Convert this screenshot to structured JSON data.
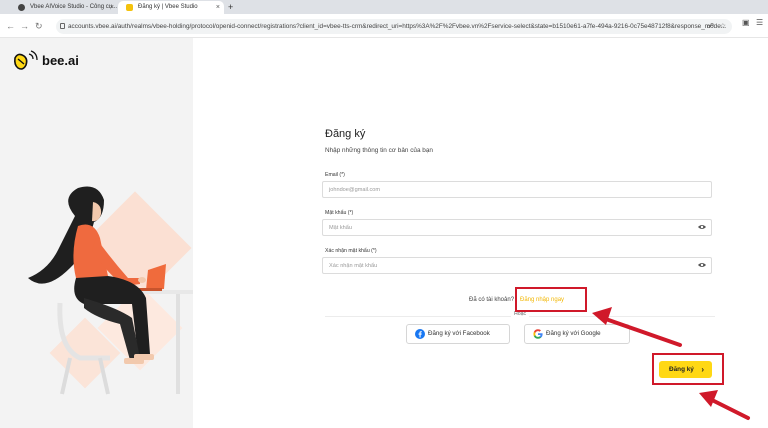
{
  "browser": {
    "tabs": [
      {
        "title": "Vbee AIVoice Studio - Công cụ...",
        "active": false
      },
      {
        "title": "Đăng ký | Vbee Studio",
        "active": true
      }
    ],
    "new_tab": "+",
    "close": "×",
    "url": "accounts.vbee.ai/auth/realms/vbee-holding/protocol/openid-connect/registrations?client_id=vbee-tts-crm&redirect_uri=https%3A%2F%2Fvbee.vn%2Fservice-select&state=b1510e61-a7fe-494a-9216-0c75e48712f8&response_mode..."
  },
  "brand": {
    "logo_text": "bee.ai",
    "accent": "#ffd814",
    "link_color": "#f2b705"
  },
  "form": {
    "title": "Đăng ký",
    "subtitle": "Nhập những thông tin cơ bản của bạn",
    "email": {
      "label": "Email (*)",
      "placeholder": "johndoe@gmail.com"
    },
    "password": {
      "label": "Mật khẩu (*)",
      "placeholder": "Mật khẩu"
    },
    "confirm": {
      "label": "Xác nhận mật khẩu (*)",
      "placeholder": "Xác nhận mật khẩu"
    },
    "has_account": "Đã có tài khoản?",
    "login_link": "Đăng nhập ngay",
    "or": "Hoặc",
    "facebook_button": "Đăng ký với Facebook",
    "google_button": "Đăng ký với Google",
    "submit_button": "Đăng ký"
  },
  "annotation": {
    "color": "#d0192a"
  }
}
